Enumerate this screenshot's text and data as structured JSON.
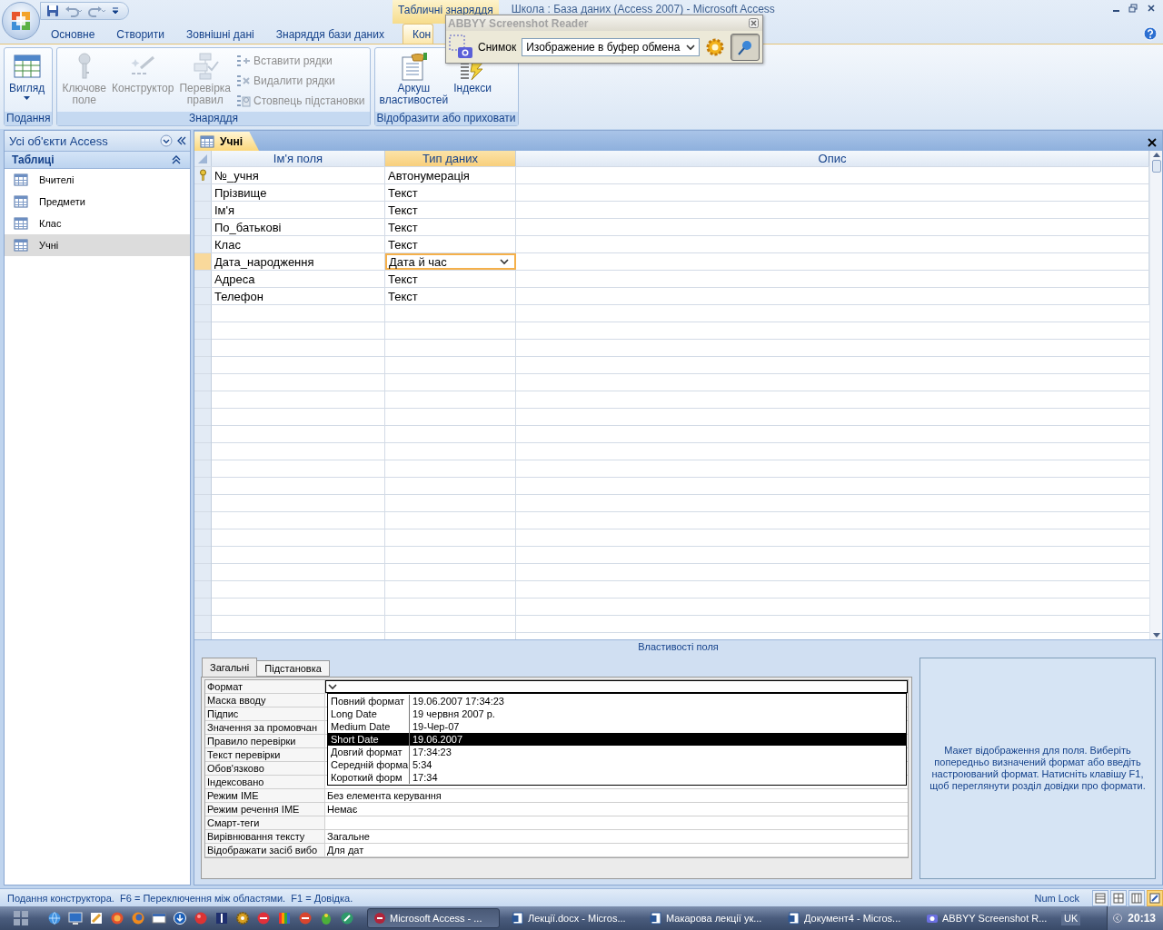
{
  "title_bar": {
    "contextual_tab": "Табличні знаряддя",
    "title": "Школа : База даних (Access 2007) - Microsoft Access"
  },
  "ribbon_tabs": [
    {
      "label": "Основне",
      "selected": false
    },
    {
      "label": "Створити",
      "selected": false
    },
    {
      "label": "Зовнішні дані",
      "selected": false
    },
    {
      "label": "Знаряддя бази даних",
      "selected": false
    },
    {
      "label": "Кон",
      "selected": true
    }
  ],
  "ribbon_groups": [
    {
      "title": "Подання",
      "buttons": [
        {
          "kind": "dropdown",
          "label": "Вигляд",
          "disabled": false
        }
      ]
    },
    {
      "title": "Знаряддя",
      "buttons": [
        {
          "kind": "large",
          "label": "Ключове поле",
          "disabled": true
        },
        {
          "kind": "large",
          "label": "Конструктор",
          "disabled": true
        },
        {
          "kind": "large",
          "label": "Перевірка правил",
          "disabled": true
        },
        {
          "kind": "small",
          "label": "Вставити рядки",
          "disabled": true
        },
        {
          "kind": "small",
          "label": "Видалити рядки",
          "disabled": true
        },
        {
          "kind": "small",
          "label": "Стовпець підстановки",
          "disabled": true
        }
      ]
    },
    {
      "title": "Відобразити або приховати",
      "buttons": [
        {
          "kind": "large",
          "label": "Аркуш властивостей",
          "disabled": false
        },
        {
          "kind": "large",
          "label": "Індекси",
          "disabled": false
        }
      ]
    }
  ],
  "screenshot_reader": {
    "title": "ABBYY Screenshot Reader",
    "capture_label": "Снимок",
    "mode": "Изображение в буфер обмена",
    "pinned": true
  },
  "navigation": {
    "title": "Усі об'єкти Access",
    "group": {
      "title": "Таблиці",
      "expanded": true,
      "items": [
        {
          "label": "Вчителі",
          "selected": false
        },
        {
          "label": "Предмети",
          "selected": false
        },
        {
          "label": "Клас",
          "selected": false
        },
        {
          "label": "Учні",
          "selected": true
        }
      ]
    }
  },
  "document_tab": {
    "label": "Учні",
    "selected": true
  },
  "table": {
    "columns": [
      {
        "label": "Ім'я поля",
        "selected": false
      },
      {
        "label": "Тип даних",
        "selected": true
      },
      {
        "label": "Опис",
        "selected": false
      }
    ],
    "rows": [
      {
        "field_name": "№_учня",
        "data_type": "Автонумерація",
        "primary_key": true,
        "selected": false
      },
      {
        "field_name": "Прізвище",
        "data_type": "Текст",
        "primary_key": false,
        "selected": false
      },
      {
        "field_name": "Ім'я",
        "data_type": "Текст",
        "primary_key": false,
        "selected": false
      },
      {
        "field_name": "По_батькові",
        "data_type": "Текст",
        "primary_key": false,
        "selected": false
      },
      {
        "field_name": "Клас",
        "data_type": "Текст",
        "primary_key": false,
        "selected": false
      },
      {
        "field_name": "Дата_народження",
        "data_type": "Дата й час",
        "primary_key": false,
        "selected": true
      },
      {
        "field_name": "Адреса",
        "data_type": "Текст",
        "primary_key": false,
        "selected": false
      },
      {
        "field_name": "Телефон",
        "data_type": "Текст",
        "primary_key": false,
        "selected": false
      }
    ]
  },
  "field_properties": {
    "caption": "Властивості поля",
    "tabs": [
      {
        "label": "Загальні",
        "selected": true
      },
      {
        "label": "Підстановка",
        "selected": false
      }
    ],
    "rows": [
      {
        "label": "Формат",
        "active": true
      },
      {
        "label": "Маска вводу",
        "active": false
      },
      {
        "label": "Підпис",
        "active": false
      },
      {
        "label": "Значення за промовчан",
        "active": false
      },
      {
        "label": "Правило перевірки",
        "active": false
      },
      {
        "label": "Текст перевірки",
        "active": false
      },
      {
        "label": "Обов'язково",
        "active": false
      },
      {
        "label": "Індексовано",
        "active": false
      },
      {
        "label": "Режим IME",
        "value": "Без елемента керування",
        "active": false
      },
      {
        "label": "Режим речення IME",
        "value": "Немає",
        "active": false
      },
      {
        "label": "Смарт-теги",
        "active": false
      },
      {
        "label": "Вирівнювання тексту",
        "value": "Загальне",
        "active": false
      },
      {
        "label": "Відображати засіб вибо",
        "value": "Для дат",
        "active": false
      }
    ],
    "format_dropdown": {
      "open": true,
      "options": [
        {
          "name": "Повний формат",
          "example": "19.06.2007 17:34:23",
          "selected": false
        },
        {
          "name": "Long Date",
          "example": "19 червня 2007 р.",
          "selected": false
        },
        {
          "name": "Medium Date",
          "example": "19-Чер-07",
          "selected": false
        },
        {
          "name": "Short Date",
          "example": "19.06.2007",
          "selected": true
        },
        {
          "name": "Довгий формат",
          "example": "17:34:23",
          "selected": false
        },
        {
          "name": "Середній форма",
          "example": "5:34",
          "selected": false
        },
        {
          "name": "Короткий форм",
          "example": "17:34",
          "selected": false
        }
      ]
    },
    "help": "Макет відображення для поля.  Виберіть попередньо визначений формат або введіть настроюваний формат.  Натисніть клавішу F1, щоб переглянути розділ довідки про формати."
  },
  "status_bar": {
    "text": "Подання конструктора.  F6 = Переключення між областями.  F1 = Довідка.",
    "indicator": "Num Lock",
    "views": [
      {
        "selected": false
      },
      {
        "selected": false
      },
      {
        "selected": false
      },
      {
        "selected": true
      }
    ]
  },
  "taskbar": {
    "tasks": [
      {
        "label": "Microsoft Access - ...",
        "selected": true
      },
      {
        "label": "Лекції.docx - Micros...",
        "selected": false
      },
      {
        "label": "Макарова лекції ук...",
        "selected": false
      },
      {
        "label": "Документ4 - Micros...",
        "selected": false
      },
      {
        "label": "ABBYY Screenshot R...",
        "selected": false
      }
    ],
    "language": "UK",
    "clock": "20:13"
  }
}
